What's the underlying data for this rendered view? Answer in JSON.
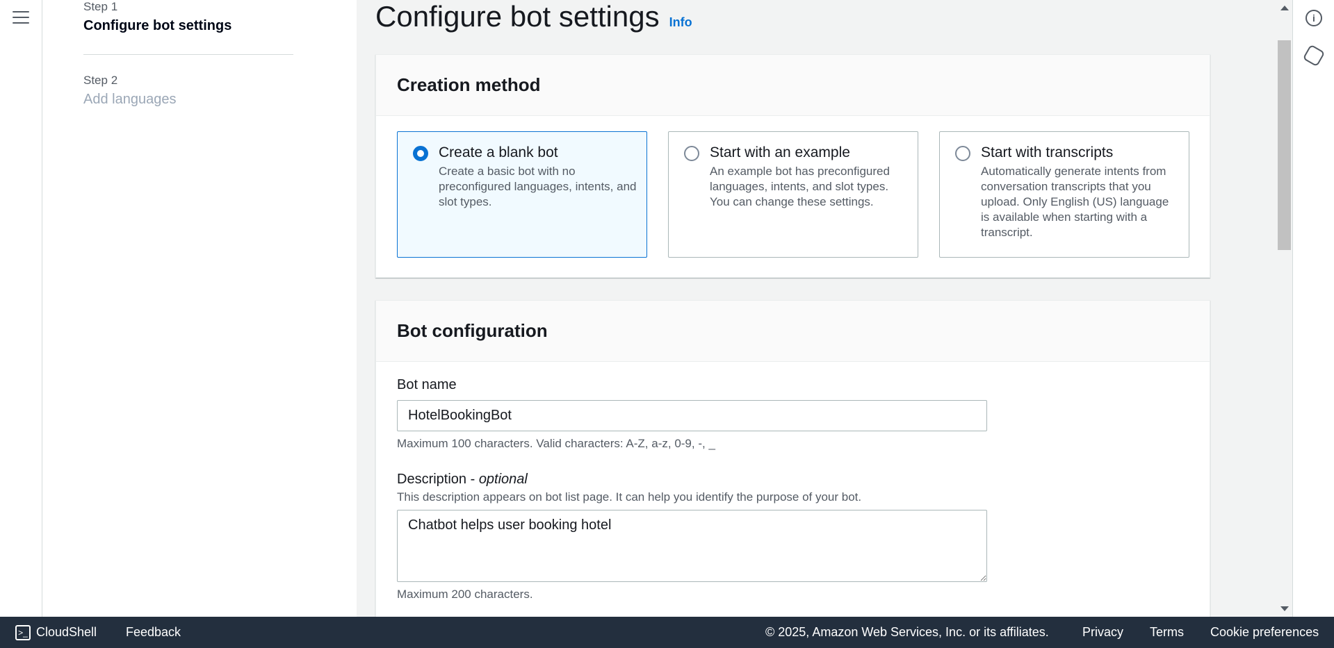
{
  "steps": [
    {
      "num": "Step 1",
      "title": "Configure bot settings"
    },
    {
      "num": "Step 2",
      "title": "Add languages"
    }
  ],
  "page": {
    "title": "Configure bot settings",
    "info": "Info"
  },
  "creation": {
    "header": "Creation method",
    "options": [
      {
        "title": "Create a blank bot",
        "desc": "Create a basic bot with no preconfigured languages, intents, and slot types.",
        "selected": true
      },
      {
        "title": "Start with an example",
        "desc": "An example bot has preconfigured languages, intents, and slot types. You can change these settings.",
        "selected": false
      },
      {
        "title": "Start with transcripts",
        "desc": "Automatically generate intents from conversation transcripts that you upload. Only English (US) language is available when starting with a transcript.",
        "selected": false
      }
    ]
  },
  "config": {
    "header": "Bot configuration",
    "name_label": "Bot name",
    "name_value": "HotelBookingBot",
    "name_constraint": "Maximum 100 characters. Valid characters: A-Z, a-z, 0-9, -, _",
    "desc_label": "Description - ",
    "desc_optional": "optional",
    "desc_help": "This description appears on bot list page. It can help you identify the purpose of your bot.",
    "desc_value": "Chatbot helps user booking hotel",
    "desc_constraint": "Maximum 200 characters."
  },
  "footer": {
    "cloudshell": "CloudShell",
    "feedback": "Feedback",
    "copyright": "© 2025, Amazon Web Services, Inc. or its affiliates.",
    "privacy": "Privacy",
    "terms": "Terms",
    "cookies": "Cookie preferences"
  },
  "icons": {
    "menu": "hamburger-menu-icon",
    "info": "info-icon",
    "side": "hexagon-icon",
    "cloudshell": "terminal-icon"
  },
  "colors": {
    "accent": "#0972d3",
    "footer_bg": "#232f3e"
  }
}
